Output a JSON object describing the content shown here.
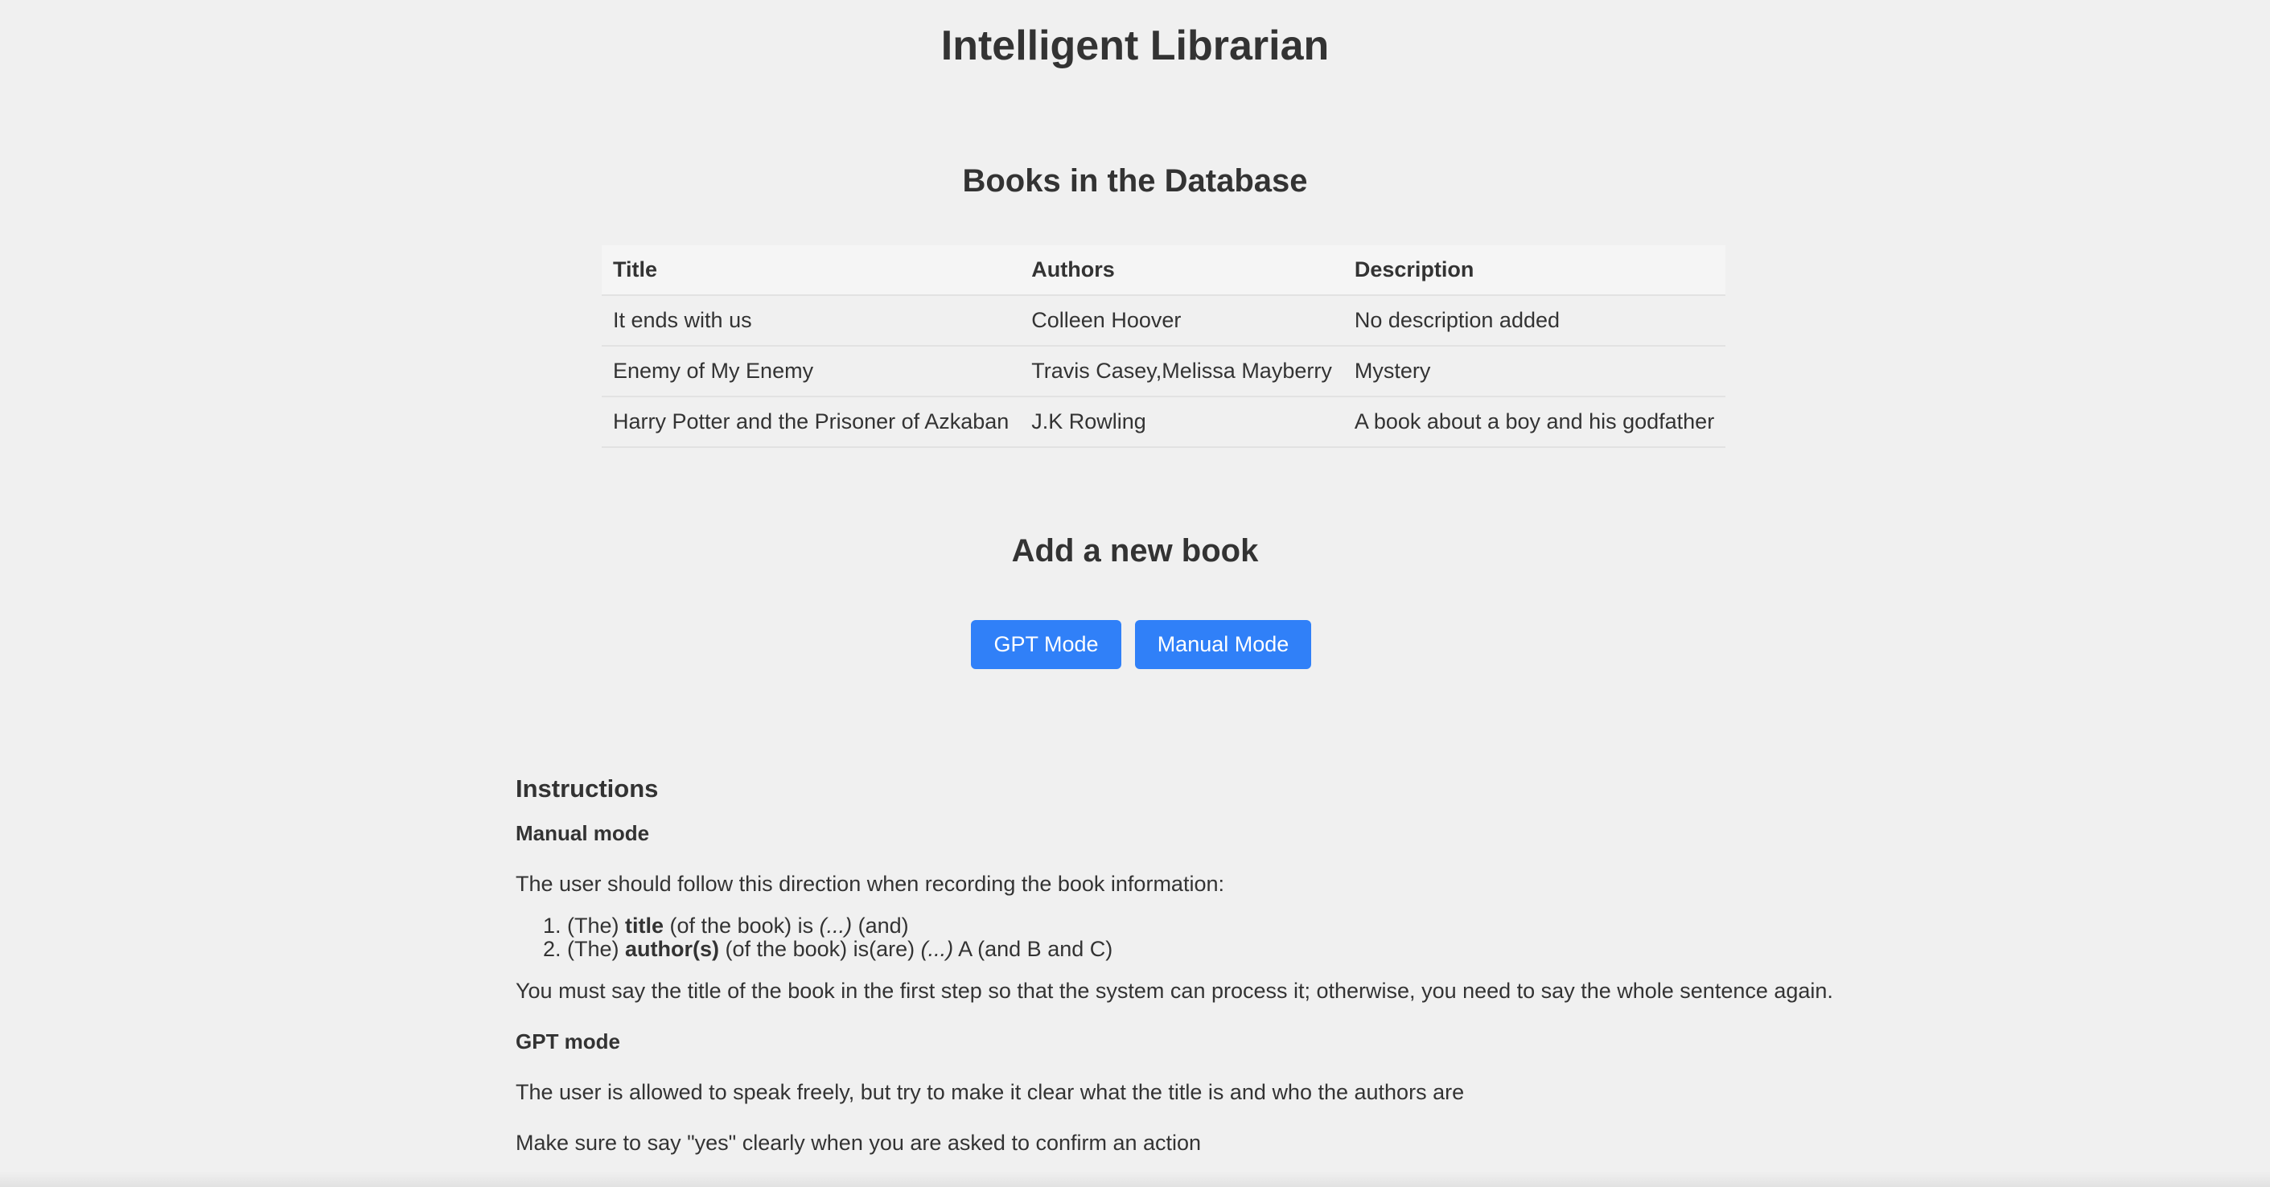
{
  "header": {
    "title": "Intelligent Librarian"
  },
  "books_section": {
    "title": "Books in the Database",
    "columns": [
      "Title",
      "Authors",
      "Description"
    ],
    "rows": [
      [
        "It ends with us",
        "Colleen Hoover",
        "No description added"
      ],
      [
        "Enemy of My Enemy",
        "Travis Casey,Melissa Mayberry",
        "Mystery"
      ],
      [
        "Harry Potter and the Prisoner of Azkaban",
        "J.K Rowling",
        "A book about a boy and his godfather"
      ]
    ]
  },
  "add_section": {
    "title": "Add a new book",
    "gpt_button": "GPT Mode",
    "manual_button": "Manual Mode"
  },
  "instructions": {
    "title": "Instructions",
    "manual_heading": "Manual mode",
    "manual_intro": "The user should follow this direction when recording the book information:",
    "step1": {
      "prefix": "(The) ",
      "bold": "title",
      "middle": " (of the book) is ",
      "italic": "(...)",
      "suffix": " (and)"
    },
    "step2": {
      "prefix": "(The) ",
      "bold": "author(s)",
      "middle": " (of the book) is(are) ",
      "italic": "(...)",
      "suffix": " A (and B and C)"
    },
    "manual_note": "You must say the title of the book in the first step so that the system can process it; otherwise, you need to say the whole sentence again.",
    "gpt_heading": "GPT mode",
    "gpt_text": "The user is allowed to speak freely, but try to make it clear what the title is and who the authors are",
    "confirm_text": "Make sure to say \"yes\" clearly when you are asked to confirm an action"
  },
  "colors": {
    "background": "#f0f0f0",
    "text": "#333333",
    "button": "#3080f8",
    "button_text": "#ffffff"
  }
}
